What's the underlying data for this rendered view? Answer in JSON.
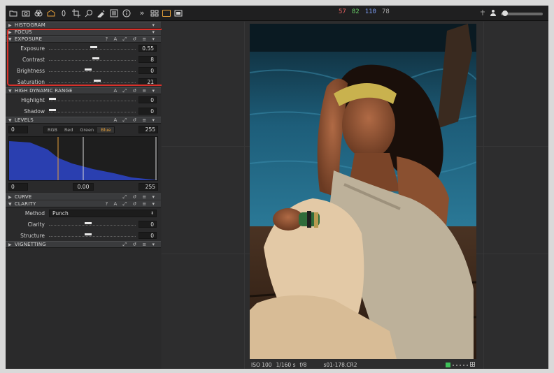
{
  "toolbar": {
    "icons": [
      "folder-icon",
      "camera-icon",
      "layers-icon",
      "home-icon",
      "lens-icon",
      "crop-icon",
      "loupe-icon",
      "picker-icon",
      "details-icon",
      "info-icon",
      "more-icon",
      "grid-view-icon",
      "single-view-icon",
      "compare-view-icon"
    ],
    "more_glyph": "»",
    "readout": {
      "r": "57",
      "g": "82",
      "b": "110",
      "a": "78"
    }
  },
  "tools": {
    "histogram": "HISTOGRAM",
    "focus": "FOCUS",
    "exposure": {
      "title": "EXPOSURE",
      "rows": [
        {
          "label": "Exposure",
          "value": "0.55",
          "level": 0.52
        },
        {
          "label": "Contrast",
          "value": "8",
          "level": 0.54
        },
        {
          "label": "Brightness",
          "value": "0",
          "level": 0.45
        },
        {
          "label": "Saturation",
          "value": "21",
          "level": 0.56
        }
      ]
    },
    "hdr": {
      "title": "HIGH DYNAMIC RANGE",
      "rows": [
        {
          "label": "Highlight",
          "value": "0",
          "level": 0.0
        },
        {
          "label": "Shadow",
          "value": "0",
          "level": 0.0
        }
      ]
    },
    "levels": {
      "title": "LEVELS",
      "input_low": "0",
      "input_high": "255",
      "channels": [
        "RGB",
        "Red",
        "Green",
        "Blue"
      ],
      "active_channel": "Blue",
      "output_low": "0",
      "midpoint": "0.00",
      "output_high": "255"
    },
    "curve": "CURVE",
    "clarity": {
      "title": "CLARITY",
      "method_label": "Method",
      "method_value": "Punch",
      "rows": [
        {
          "label": "Clarity",
          "value": "0",
          "level": 0.45
        },
        {
          "label": "Structure",
          "value": "0",
          "level": 0.45
        }
      ]
    },
    "vignetting": "VIGNETTING"
  },
  "image": {
    "iso": "ISO 100",
    "shutter": "1/160 s",
    "aperture": "f/8",
    "filename": "s01-178.CR2"
  },
  "colors": {
    "accent": "#e8a23a",
    "highlight_box": "#d8312a",
    "histogram_fill": "#2a3fb0"
  }
}
